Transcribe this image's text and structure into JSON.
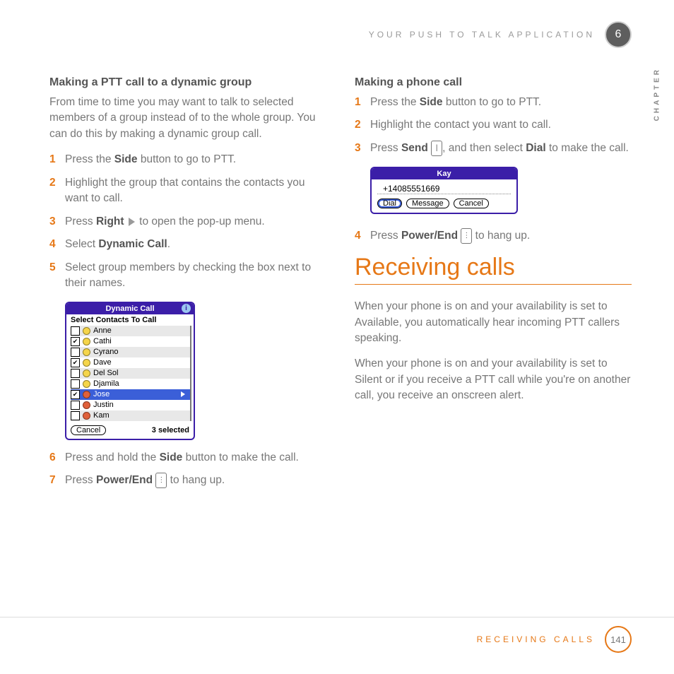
{
  "header": {
    "section": "YOUR PUSH TO TALK APPLICATION",
    "chapter_num": "6",
    "chapter_label": "CHAPTER"
  },
  "left": {
    "heading": "Making a PTT call to a dynamic group",
    "intro": "From time to time you may want to talk to selected members of a group instead of to the whole group. You can do this by making a dynamic group call.",
    "steps": {
      "s1": {
        "n": "1",
        "a": "Press the ",
        "b": "Side",
        "c": " button to go to PTT."
      },
      "s2": {
        "n": "2",
        "t": "Highlight the group that contains the contacts you want to call."
      },
      "s3": {
        "n": "3",
        "a": "Press ",
        "b": "Right",
        "c": " to open the pop-up menu."
      },
      "s4": {
        "n": "4",
        "a": "Select ",
        "b": "Dynamic Call",
        "c": "."
      },
      "s5": {
        "n": "5",
        "t": "Select group members by checking the box next to their names."
      },
      "s6": {
        "n": "6",
        "a": "Press and hold the ",
        "b": "Side",
        "c": " button to make the call."
      },
      "s7": {
        "n": "7",
        "a": "Press ",
        "b": "Power/End",
        "c": " to hang up."
      }
    }
  },
  "widget_dyn": {
    "title": "Dynamic Call",
    "subtitle": "Select Contacts To Call",
    "rows": [
      {
        "checked": false,
        "face": "g",
        "name": "Anne"
      },
      {
        "checked": true,
        "face": "g",
        "name": "Cathi"
      },
      {
        "checked": false,
        "face": "g",
        "name": "Cyrano"
      },
      {
        "checked": true,
        "face": "g",
        "name": "Dave"
      },
      {
        "checked": false,
        "face": "g",
        "name": "Del Sol"
      },
      {
        "checked": false,
        "face": "g",
        "name": "Djamila"
      },
      {
        "checked": true,
        "face": "r",
        "name": "Jose",
        "selected": true
      },
      {
        "checked": false,
        "face": "r",
        "name": "Justin"
      },
      {
        "checked": false,
        "face": "r",
        "name": "Kam"
      }
    ],
    "cancel": "Cancel",
    "count": "3 selected"
  },
  "right": {
    "heading": "Making a phone call",
    "steps": {
      "s1": {
        "n": "1",
        "a": "Press the ",
        "b": "Side",
        "c": " button to go to PTT."
      },
      "s2": {
        "n": "2",
        "t": "Highlight the contact you want to call."
      },
      "s3": {
        "n": "3",
        "a": "Press ",
        "b": "Send",
        "c": ", and then select ",
        "d": "Dial",
        "e": " to make the call."
      },
      "s4": {
        "n": "4",
        "a": "Press ",
        "b": "Power/End",
        "c": " to hang up."
      }
    }
  },
  "widget_phone": {
    "title": "Kay",
    "number": "+14085551669",
    "buttons": {
      "dial": "Dial",
      "message": "Message",
      "cancel": "Cancel"
    }
  },
  "section_title": "Receiving calls",
  "para1": "When your phone is on and your availability is set to Available, you automatically hear incoming PTT callers speaking.",
  "para2": "When your phone is on and your availability is set to Silent or if you receive a PTT call while you're on another call, you receive an onscreen alert.",
  "footer": {
    "title": "RECEIVING CALLS",
    "page": "141"
  }
}
